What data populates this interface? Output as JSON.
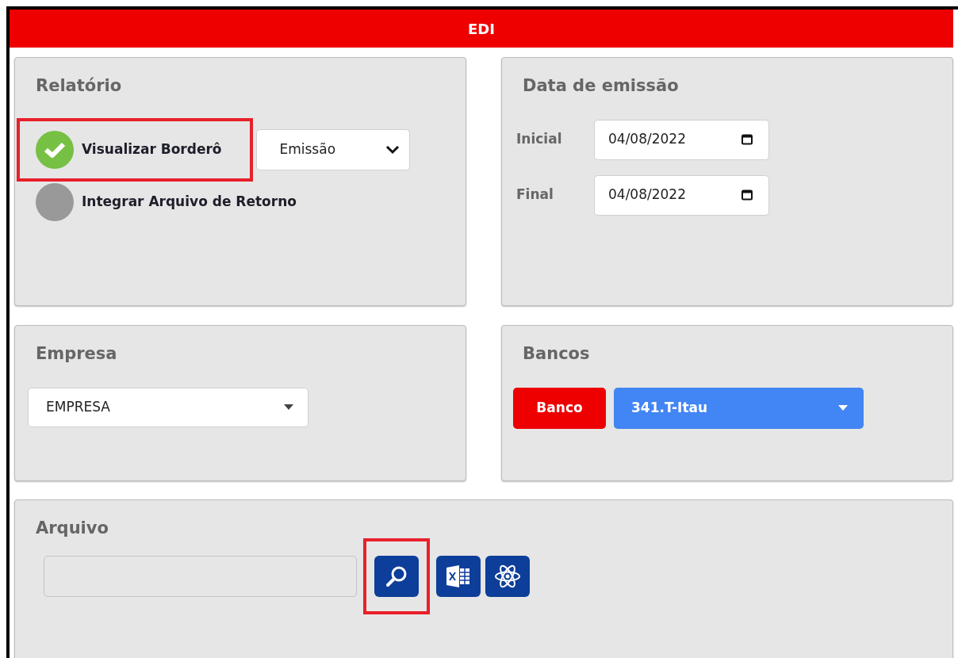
{
  "header": {
    "title": "EDI"
  },
  "relatorio": {
    "title": "Relatório",
    "options": [
      {
        "label": "Visualizar Borderô",
        "selected": true,
        "highlighted": true
      },
      {
        "label": "Integrar Arquivo de Retorno",
        "selected": false,
        "highlighted": false
      }
    ],
    "order_select": {
      "value": "Emissão"
    }
  },
  "data_emissao": {
    "title": "Data de emissão",
    "fields": [
      {
        "label": "Inicial",
        "value": "04/08/2022"
      },
      {
        "label": "Final",
        "value": "04/08/2022"
      }
    ]
  },
  "empresa": {
    "title": "Empresa",
    "select": {
      "value": "EMPRESA"
    }
  },
  "bancos": {
    "title": "Bancos",
    "label": "Banco",
    "select": {
      "value": "341.T-Itau"
    }
  },
  "arquivo": {
    "title": "Arquivo",
    "buttons": [
      {
        "kind": "search",
        "highlighted": true
      },
      {
        "kind": "excel",
        "highlighted": false
      },
      {
        "kind": "atom",
        "highlighted": false
      }
    ]
  }
}
